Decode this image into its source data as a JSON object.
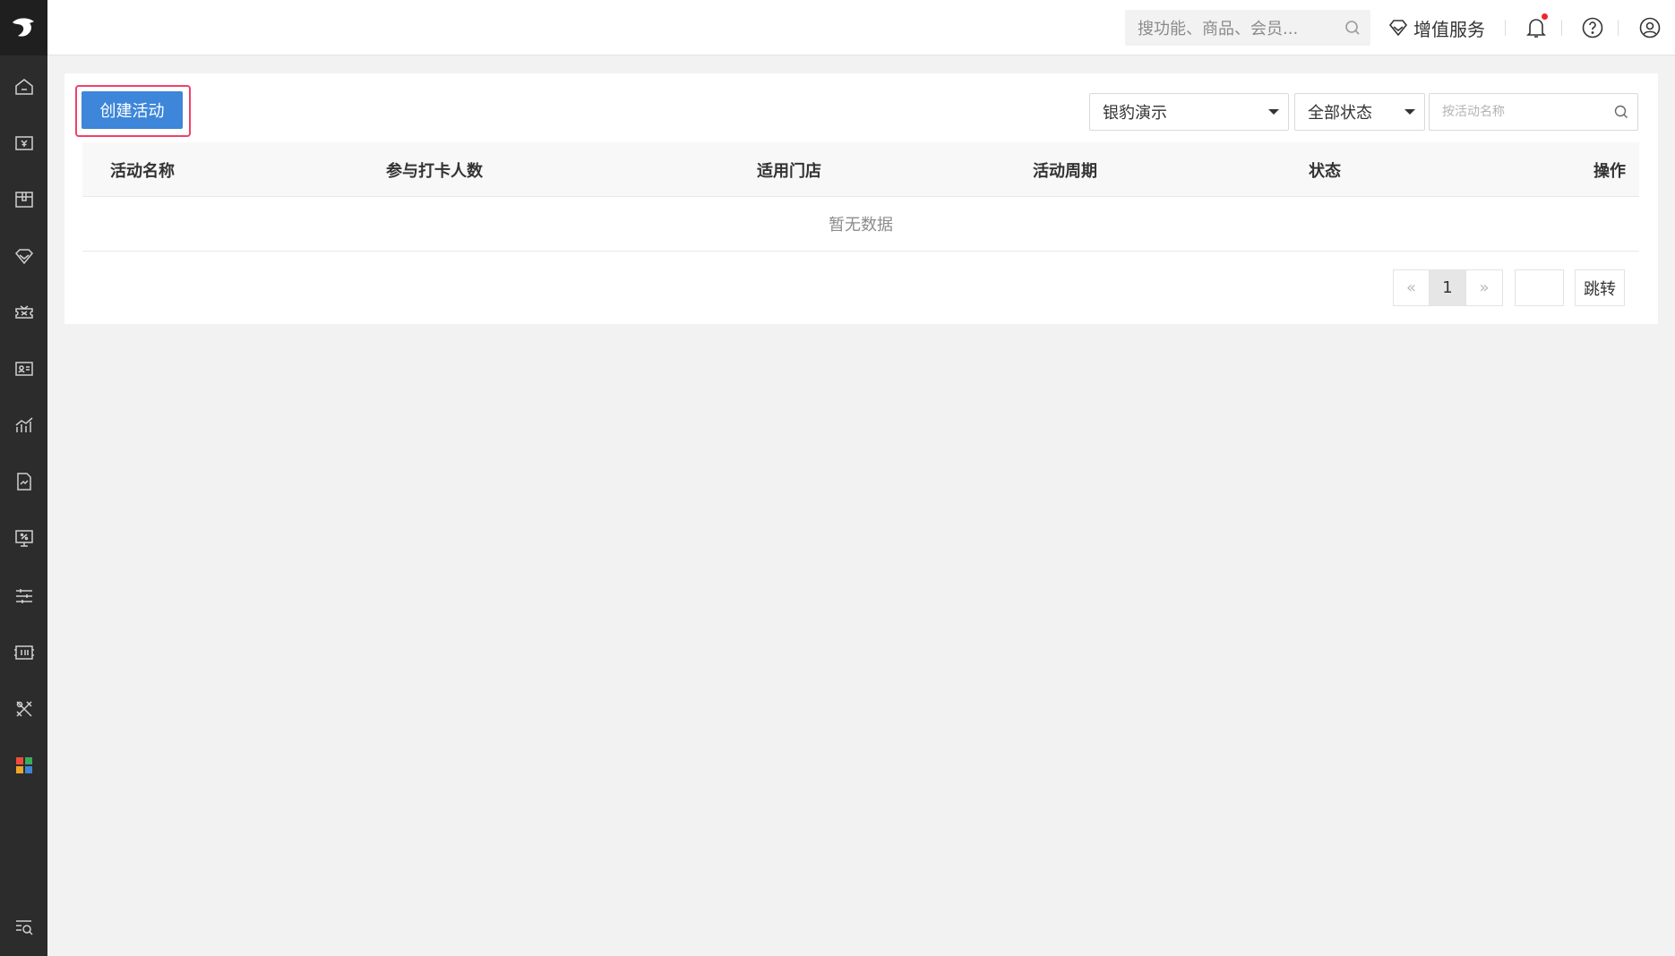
{
  "header": {
    "search_placeholder": "搜功能、商品、会员...",
    "value_added_label": "增值服务",
    "has_notification": true
  },
  "sidebar": {
    "items": [
      {
        "icon": "home-icon"
      },
      {
        "icon": "cashier-icon"
      },
      {
        "icon": "goods-icon"
      },
      {
        "icon": "member-diamond-icon"
      },
      {
        "icon": "coupon-icon"
      },
      {
        "icon": "member-card-icon"
      },
      {
        "icon": "chart-icon"
      },
      {
        "icon": "report-icon"
      },
      {
        "icon": "promotion-screen-icon"
      },
      {
        "icon": "settings-sliders-icon"
      },
      {
        "icon": "device-icon"
      },
      {
        "icon": "tools-icon"
      },
      {
        "icon": "apps-grid-icon"
      }
    ],
    "bottom_icon": "menu-search-icon"
  },
  "toolbar": {
    "create_label": "创建活动",
    "store_select": "银豹演示",
    "status_select": "全部状态",
    "name_search_placeholder": "按活动名称"
  },
  "table": {
    "columns": [
      "活动名称",
      "参与打卡人数",
      "适用门店",
      "活动周期",
      "状态",
      "操作"
    ],
    "rows": [],
    "empty_text": "暂无数据"
  },
  "pagination": {
    "prev": "«",
    "current_page": "1",
    "next": "»",
    "jump_label": "跳转"
  },
  "colors": {
    "primary": "#3d86d9",
    "highlight_border": "#f0416a",
    "sidebar_bg": "#2c2c2c",
    "notification_dot": "#f0262e"
  }
}
